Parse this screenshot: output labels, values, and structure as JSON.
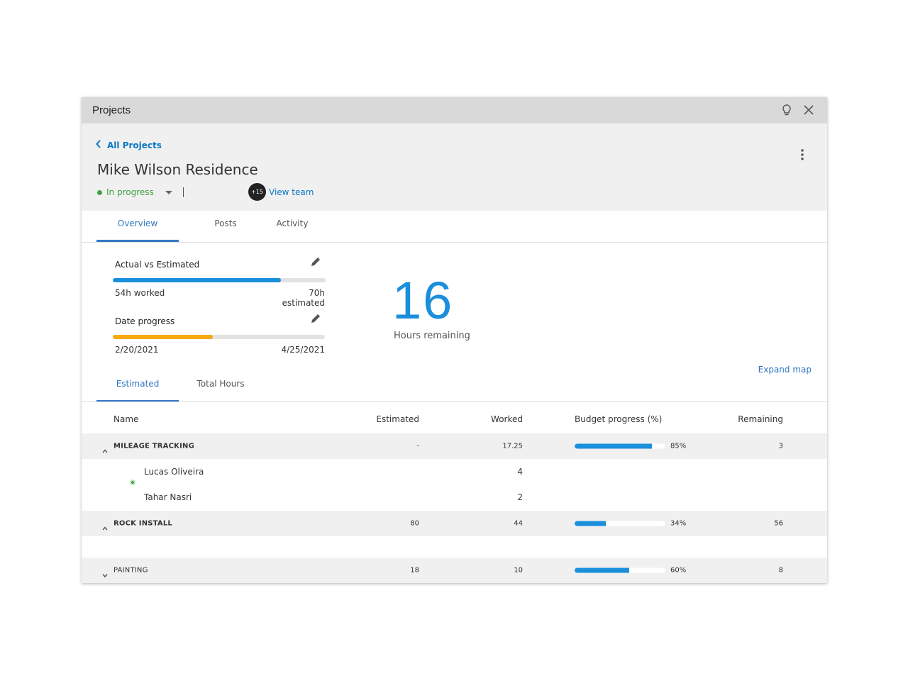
{
  "window": {
    "title": "Projects",
    "icons": [
      "lightbulb-icon",
      "close-icon"
    ]
  },
  "header": {
    "back_label": "All Projects",
    "project_title": "Mike Wilson Residence",
    "status": "In progress",
    "status_color": "#3ea33e",
    "team_count_badge": "+15",
    "view_team_label": "View team",
    "more_icon": "kebab-menu-icon"
  },
  "tabs": [
    {
      "label": "Overview",
      "active": true
    },
    {
      "label": "Posts",
      "active": false
    },
    {
      "label": "Activity",
      "active": false
    }
  ],
  "overview": {
    "actual_vs_estimated": {
      "label": "Actual vs Estimated",
      "worked_label": "54h worked",
      "estimated_label": "70h estimated",
      "progress": 0.79,
      "color": "#1a8fdb"
    },
    "date_progress": {
      "label": "Date progress",
      "start": "2/20/2021",
      "end": "4/25/2021",
      "progress": 0.47,
      "color": "#f5a90a"
    },
    "hours_remaining": {
      "value": "16",
      "label": "Hours remaining"
    },
    "expand_map_label": "Expand map"
  },
  "subtabs": [
    {
      "label": "Estimated",
      "active": true
    },
    {
      "label": "Total Hours",
      "active": false
    }
  ],
  "table": {
    "columns": [
      "Name",
      "Estimated",
      "Worked",
      "Budget progress (%)",
      "Remaining"
    ],
    "groups": [
      {
        "name": "MILEAGE TRACKING",
        "expanded": true,
        "estimated": "-",
        "worked": "17.25",
        "budget_progress": 85,
        "budget_label": "85%",
        "remaining": "3",
        "members": [
          {
            "name": "Lucas Oliveira",
            "worked": "4",
            "online": true
          },
          {
            "name": "Tahar Nasri",
            "worked": "2",
            "online": false
          }
        ]
      },
      {
        "name": "ROCK INSTALL",
        "expanded": true,
        "estimated": "80",
        "worked": "44",
        "budget_progress": 34,
        "budget_label": "34%",
        "remaining": "56",
        "members": []
      },
      {
        "name": "PAINTING",
        "expanded": false,
        "estimated": "18",
        "worked": "10",
        "budget_progress": 60,
        "budget_label": "60%",
        "remaining": "8",
        "members": []
      }
    ]
  }
}
